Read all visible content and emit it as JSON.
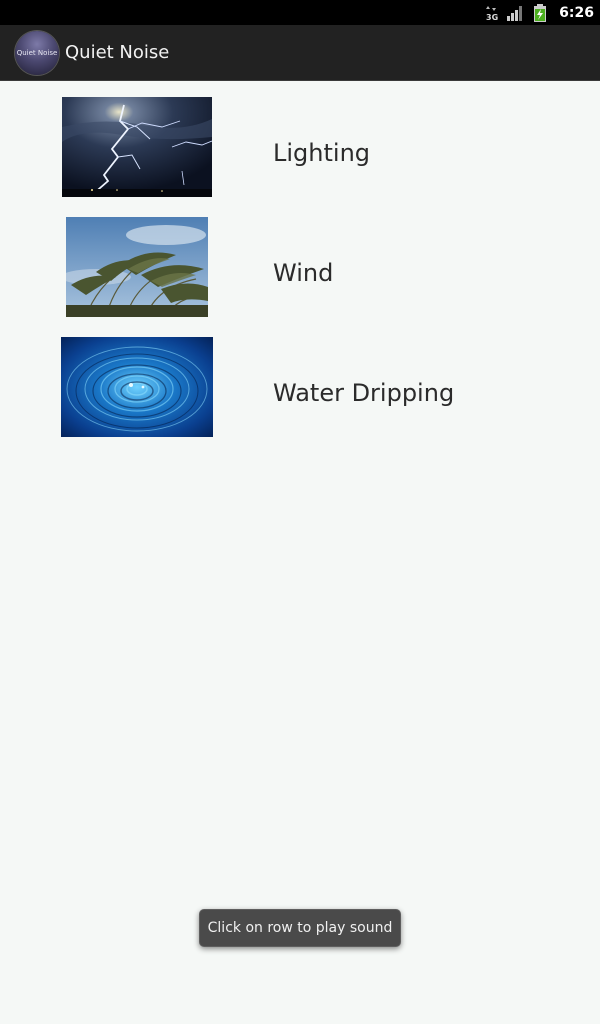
{
  "status_bar": {
    "time": "6:26",
    "network_label": "3G",
    "icons": [
      "network-3g-icon",
      "signal-icon",
      "battery-charging-icon"
    ]
  },
  "action_bar": {
    "title": "Quiet Noise",
    "icon_text": "Quiet Noise"
  },
  "sounds": [
    {
      "label": "Lighting",
      "image": "lightning-image"
    },
    {
      "label": "Wind",
      "image": "wind-grass-image"
    },
    {
      "label": "Water Dripping",
      "image": "water-ripple-image"
    }
  ],
  "toast": {
    "message": "Click on row to play sound"
  },
  "colors": {
    "status_bar": "#000000",
    "action_bar": "#222222",
    "background": "#f5f8f6",
    "toast": "#4a4a4a",
    "battery": "#4caf1f"
  }
}
